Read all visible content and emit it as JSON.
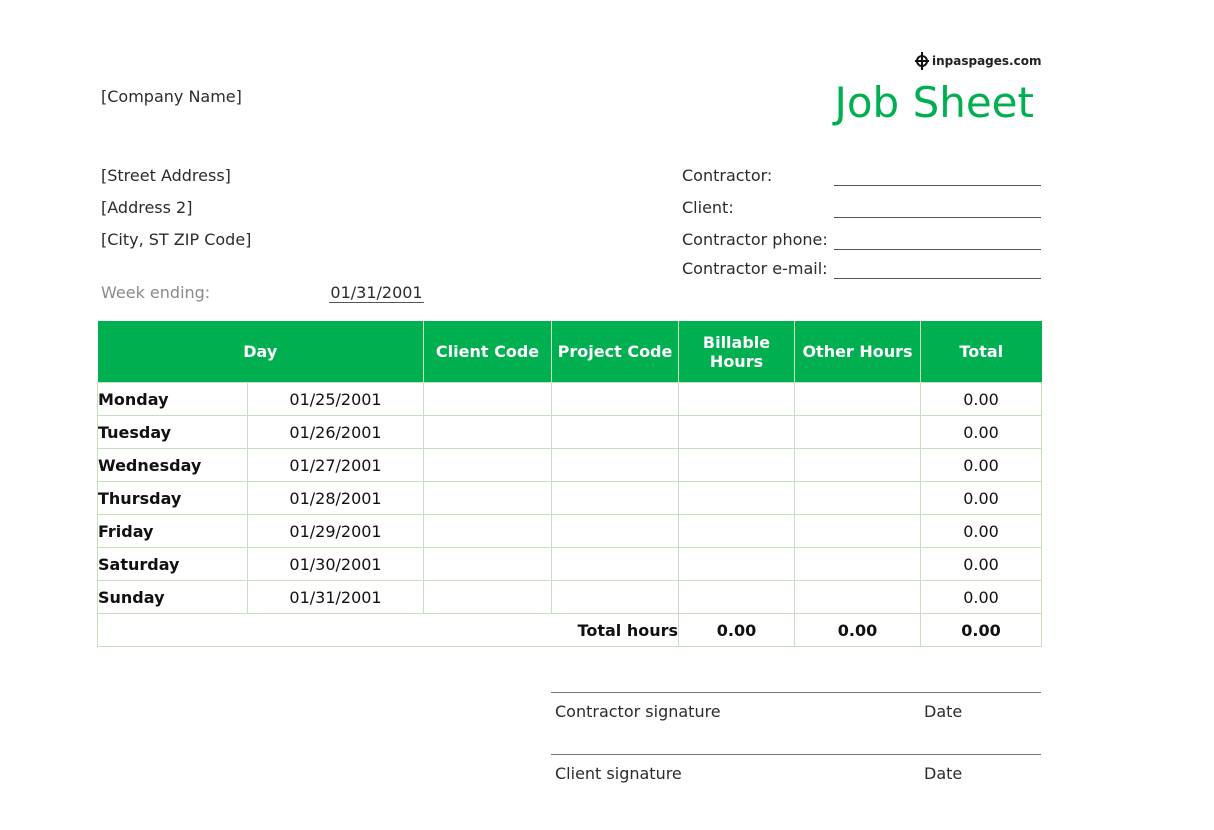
{
  "logo": {
    "text": "inpaspages.com",
    "icon": "crosshair-logo-icon"
  },
  "document": {
    "title": "Job Sheet"
  },
  "company": {
    "name": "[Company Name]",
    "street": "[Street Address]",
    "address2": "[Address 2]",
    "city": "[City, ST  ZIP Code]"
  },
  "week": {
    "label": "Week ending:",
    "value": "01/31/2001"
  },
  "contact_fields": [
    {
      "label": "Contractor:",
      "value": ""
    },
    {
      "label": "Client:",
      "value": ""
    },
    {
      "label": "Contractor phone:",
      "value": ""
    },
    {
      "label": "Contractor e-mail:",
      "value": ""
    }
  ],
  "table": {
    "headers": {
      "day": "Day",
      "client_code": "Client Code",
      "project_code": "Project Code",
      "billable_hours": "Billable Hours",
      "other_hours": "Other Hours",
      "total": "Total"
    },
    "rows": [
      {
        "day": "Monday",
        "date": "01/25/2001",
        "client_code": "",
        "project_code": "",
        "billable": "",
        "other": "",
        "total": "0.00"
      },
      {
        "day": "Tuesday",
        "date": "01/26/2001",
        "client_code": "",
        "project_code": "",
        "billable": "",
        "other": "",
        "total": "0.00"
      },
      {
        "day": "Wednesday",
        "date": "01/27/2001",
        "client_code": "",
        "project_code": "",
        "billable": "",
        "other": "",
        "total": "0.00"
      },
      {
        "day": "Thursday",
        "date": "01/28/2001",
        "client_code": "",
        "project_code": "",
        "billable": "",
        "other": "",
        "total": "0.00"
      },
      {
        "day": "Friday",
        "date": "01/29/2001",
        "client_code": "",
        "project_code": "",
        "billable": "",
        "other": "",
        "total": "0.00"
      },
      {
        "day": "Saturday",
        "date": "01/30/2001",
        "client_code": "",
        "project_code": "",
        "billable": "",
        "other": "",
        "total": "0.00"
      },
      {
        "day": "Sunday",
        "date": "01/31/2001",
        "client_code": "",
        "project_code": "",
        "billable": "",
        "other": "",
        "total": "0.00"
      }
    ],
    "totals": {
      "label": "Total hours",
      "billable": "0.00",
      "other": "0.00",
      "total": "0.00"
    }
  },
  "signatures": [
    {
      "label": "Contractor signature",
      "date_label": "Date"
    },
    {
      "label": "Client signature",
      "date_label": "Date"
    }
  ],
  "colors": {
    "accent": "#00b050",
    "grid": "#c6dfc0"
  }
}
